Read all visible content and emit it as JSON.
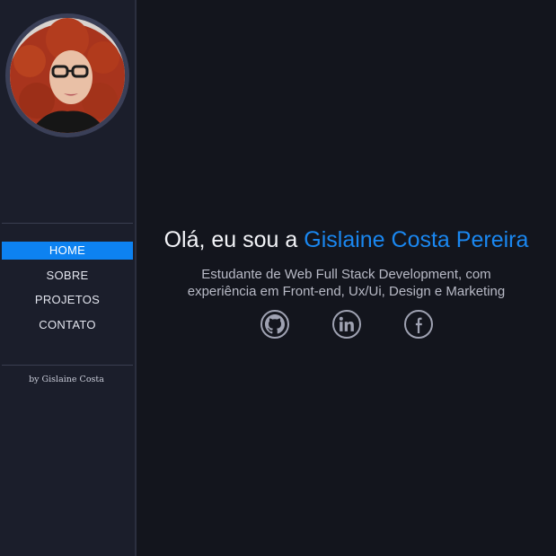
{
  "sidebar": {
    "nav": [
      {
        "label": "HOME",
        "active": true
      },
      {
        "label": "SOBRE",
        "active": false
      },
      {
        "label": "PROJETOS",
        "active": false
      },
      {
        "label": "CONTATO",
        "active": false
      }
    ],
    "credit": "by Gislaine Costa"
  },
  "hero": {
    "greeting": "Olá, eu sou a ",
    "name": "Gislaine Costa Pereira",
    "subtitle_line1": "Estudante de Web Full Stack Development, com",
    "subtitle_line2": "experiência em Front-end, Ux/Ui, Design e Marketing"
  },
  "socials": [
    {
      "icon": "github-icon"
    },
    {
      "icon": "linkedin-icon"
    },
    {
      "icon": "facebook-icon"
    }
  ],
  "colors": {
    "accent": "#0d82f1",
    "name_text": "#1a87f0",
    "background": "#13151d",
    "sidebar": "#1b1e2b"
  }
}
